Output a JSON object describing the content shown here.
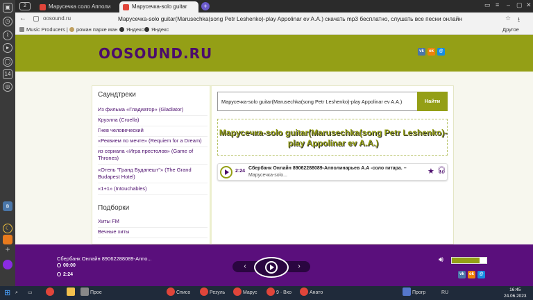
{
  "browser": {
    "tab_count": "2",
    "tabs": [
      {
        "label": "Марусечка соло Апполи",
        "icon_color": "#e0453a",
        "active": false
      },
      {
        "label": "Марусечка-solo guitar",
        "icon_color": "#e0453a",
        "active": true
      }
    ],
    "url": "oosound.ru",
    "page_title": "Марусечка-solo guitar(Marusechka(song Petr Leshenko)-play Appolinar ev A.A.) скачать mp3 бесплатно, слушать все песни онлайн",
    "bookmarks": [
      "Music Producers |",
      "роман парке ман",
      "Яндекс",
      "Яндекс"
    ],
    "bookmarks_other": "Другое"
  },
  "site": {
    "logo": "OOSOUND.RU",
    "social": [
      {
        "icon": "vk-icon",
        "label": "vk",
        "color": "#4a76a8"
      },
      {
        "icon": "ok-icon",
        "label": "ok",
        "color": "#ee8208"
      },
      {
        "icon": "mail-icon",
        "label": "@",
        "color": "#168de2"
      }
    ]
  },
  "sidebar": {
    "soundtracks_title": "Саундтреки",
    "soundtracks": [
      "Из фильма «Гладиатор» (Gladiator)",
      "Круэлла (Cruella)",
      "Гнев человеческий",
      "«Реквием по мечте» (Requiem for a Dream)",
      "из сериала «Игра престолов» (Game of Thrones)",
      "«Отель \"Гранд Будапешт\"» (The Grand Budapest Hotel)",
      "«1+1» (Intouchables)"
    ],
    "collections_title": "Подборки",
    "collections": [
      "Хиты FM",
      "Вечные хиты"
    ]
  },
  "search": {
    "value": "Марусечка-solo guitar(Marusechka(song Petr Leshenko)-play Appolinar ev A.A.)",
    "button": "Найти"
  },
  "main": {
    "heading": "Марусечка-solo guitar(Marusechka(song Petr Leshenko)-play Appolinar ev A.A.)",
    "track": {
      "duration": "2:24",
      "title": "Сбербанк Онлайн 89062288089-Апполинарьев А.А -соло гитара. –",
      "subtitle": "Марусечка-solo..."
    }
  },
  "player": {
    "now_playing": "Сбербанк Онлайн 89062288089-Аппо...",
    "elapsed": "00:00",
    "total": "2:24",
    "prev": "‹",
    "next": "›",
    "volume": 0.8
  },
  "taskbar": {
    "items": [
      "Прое",
      "Списо",
      "Резуль",
      "Марус",
      "9 · Вхо",
      "Анато",
      "Прогр"
    ],
    "lang": "RU",
    "time": "16:45",
    "date": "24.06.2023"
  }
}
